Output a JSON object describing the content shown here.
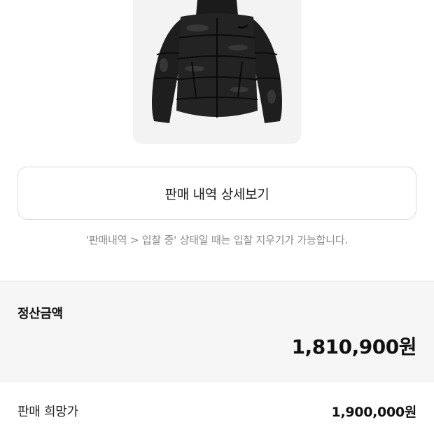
{
  "product": {
    "image_desc": "black puffer down jacket",
    "icon": "jacket-image"
  },
  "detail_button": {
    "label": "판매 내역 상세보기"
  },
  "notice": {
    "text": "'판매내역 > 입찰 중' 상태일 때는 입찰 지우기가 가능합니다."
  },
  "settlement": {
    "label": "정산금액",
    "amount": "1,810,900원"
  },
  "wish_price": {
    "label": "판매 희망가",
    "amount": "1,900,000원"
  },
  "colors": {
    "card_bg": "#f3f3f3",
    "section_bg": "#f6f6f6",
    "muted_text": "#8a8a8a",
    "border": "#dcdcdc"
  }
}
